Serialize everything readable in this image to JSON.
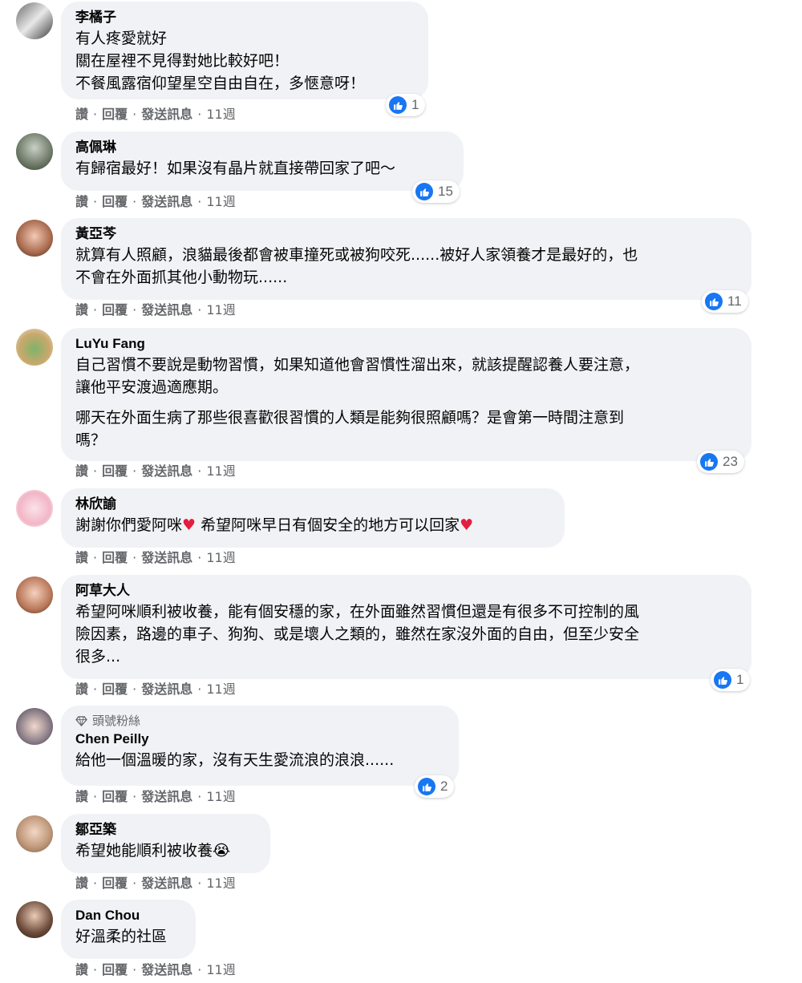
{
  "actions": {
    "like": "讚",
    "reply": "回覆",
    "message": "發送訊息",
    "time": "11週",
    "dot": "·"
  },
  "colors": {
    "bubble": "#f0f2f5",
    "like_blue": "#1877f2",
    "meta_gray": "#65676b",
    "heart_red": "#e41e3f"
  },
  "comments": [
    {
      "name": "李橘子",
      "lines": [
        "有人疼愛就好",
        "關在屋裡不見得對她比較好吧！",
        "不餐風露宿仰望星空自由自在，多愜意呀！"
      ],
      "likes": "1"
    },
    {
      "name": "高佩琳",
      "lines": [
        "有歸宿最好！如果沒有晶片就直接帶回家了吧～"
      ],
      "likes": "15"
    },
    {
      "name": "黃亞芩",
      "lines": [
        "就算有人照顧，浪貓最後都會被車撞死或被狗咬死......被好人家領養才是最好的，也",
        "不會在外面抓其他小動物玩......"
      ],
      "likes": "11"
    },
    {
      "name": "LuYu Fang",
      "lines": [
        "自己習慣不要說是動物習慣，如果知道他會習慣性溜出來，就該提醒認養人要注意，",
        "讓他平安渡過適應期。"
      ],
      "lines2": [
        "哪天在外面生病了那些很喜歡很習慣的人類是能夠很照顧嗎？是會第一時間注意到",
        "嗎？"
      ],
      "likes": "23"
    },
    {
      "name": "林欣諭",
      "text_a": "謝謝你們愛阿咪",
      "text_b": " 希望阿咪早日有個安全的地方可以回家",
      "heart": "♥"
    },
    {
      "name": "阿草大人",
      "lines": [
        "希望阿咪順利被收養，能有個安穩的家，在外面雖然習慣但還是有很多不可控制的風",
        "險因素，路邊的車子、狗狗、或是壞人之類的，雖然在家沒外面的自由，但至少安全",
        "很多..."
      ],
      "likes": "1"
    },
    {
      "badge": "頭號粉絲",
      "name": "Chen Peilly",
      "lines": [
        "給他一個溫暖的家，沒有天生愛流浪的浪浪......"
      ],
      "likes": "2"
    },
    {
      "name": "鄒亞築",
      "text": "希望她能順利被收養",
      "emoji": "😭"
    },
    {
      "name": "Dan Chou",
      "lines": [
        "好溫柔的社區"
      ]
    }
  ]
}
